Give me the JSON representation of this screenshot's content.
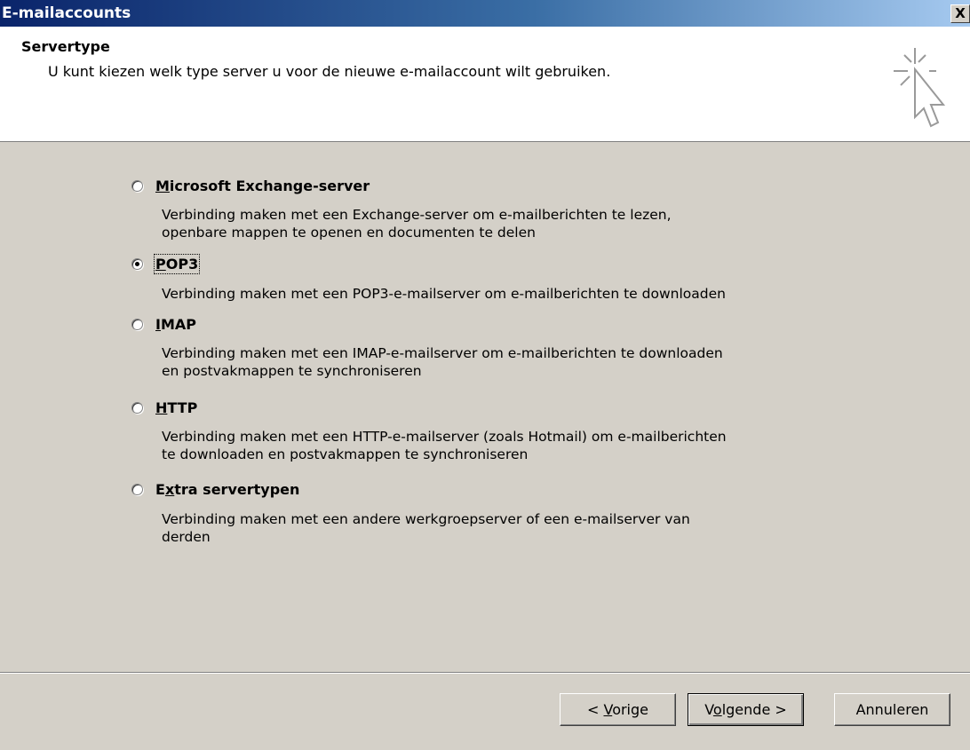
{
  "window": {
    "title": "E-mailaccounts",
    "close_label": "X"
  },
  "header": {
    "title": "Servertype",
    "subtitle": "U kunt kiezen welk type server u voor de nieuwe e-mailaccount wilt gebruiken.",
    "icon": "wizard-cursor-icon"
  },
  "options": [
    {
      "label": "Microsoft Exchange-server",
      "accel": "M",
      "selected": false,
      "description_lines": [
        "Verbinding maken met een Exchange-server om e-mailberichten te lezen,",
        "openbare mappen te openen en documenten te delen"
      ]
    },
    {
      "label": "POP3",
      "accel": "P",
      "selected": true,
      "description_lines": [
        "Verbinding maken met een POP3-e-mailserver om e-mailberichten te downloaden"
      ]
    },
    {
      "label": "IMAP",
      "accel": "I",
      "selected": false,
      "description_lines": [
        "Verbinding maken met een IMAP-e-mailserver om e-mailberichten te downloaden",
        "en postvakmappen te synchroniseren"
      ]
    },
    {
      "label": "HTTP",
      "accel": "H",
      "selected": false,
      "description_lines": [
        "Verbinding maken met een HTTP-e-mailserver (zoals Hotmail) om e-mailberichten",
        "te downloaden en postvakmappen te synchroniseren"
      ]
    },
    {
      "label": "Extra servertypen",
      "accel": "x",
      "selected": false,
      "description_lines": [
        "Verbinding maken met een andere werkgroepserver of een e-mailserver van",
        "derden"
      ]
    }
  ],
  "buttons": {
    "back": "< Vorige",
    "next": "Volgende >",
    "cancel": "Annuleren"
  }
}
